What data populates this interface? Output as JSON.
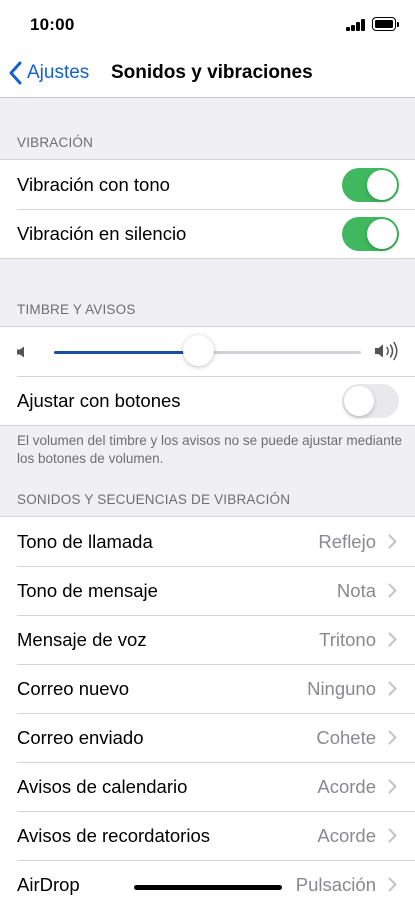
{
  "status_bar": {
    "time": "10:00"
  },
  "nav": {
    "back_label": "Ajustes",
    "title": "Sonidos y vibraciones"
  },
  "vibration": {
    "header": "VIBRACIÓN",
    "rows": [
      {
        "label": "Vibración con tono",
        "on": true
      },
      {
        "label": "Vibración en silencio",
        "on": true
      }
    ]
  },
  "ringer": {
    "header": "TIMBRE Y AVISOS",
    "volume_level": 0.47,
    "buttons_label": "Ajustar con botones",
    "buttons_on": false,
    "note": "El volumen del timbre y los avisos no se puede ajustar mediante los botones de volumen."
  },
  "sounds": {
    "header": "SONIDOS Y SECUENCIAS DE VIBRACIÓN",
    "rows": [
      {
        "label": "Tono de llamada",
        "value": "Reflejo"
      },
      {
        "label": "Tono de mensaje",
        "value": "Nota"
      },
      {
        "label": "Mensaje de voz",
        "value": "Tritono"
      },
      {
        "label": "Correo nuevo",
        "value": "Ninguno"
      },
      {
        "label": "Correo enviado",
        "value": "Cohete"
      },
      {
        "label": "Avisos de calendario",
        "value": "Acorde"
      },
      {
        "label": "Avisos de recordatorios",
        "value": "Acorde"
      },
      {
        "label": "AirDrop",
        "value": "Pulsación"
      }
    ]
  },
  "colors": {
    "accent": "#1462c8",
    "toggle_on": "#3fb85f",
    "slider_fill": "#1a4fa8"
  }
}
